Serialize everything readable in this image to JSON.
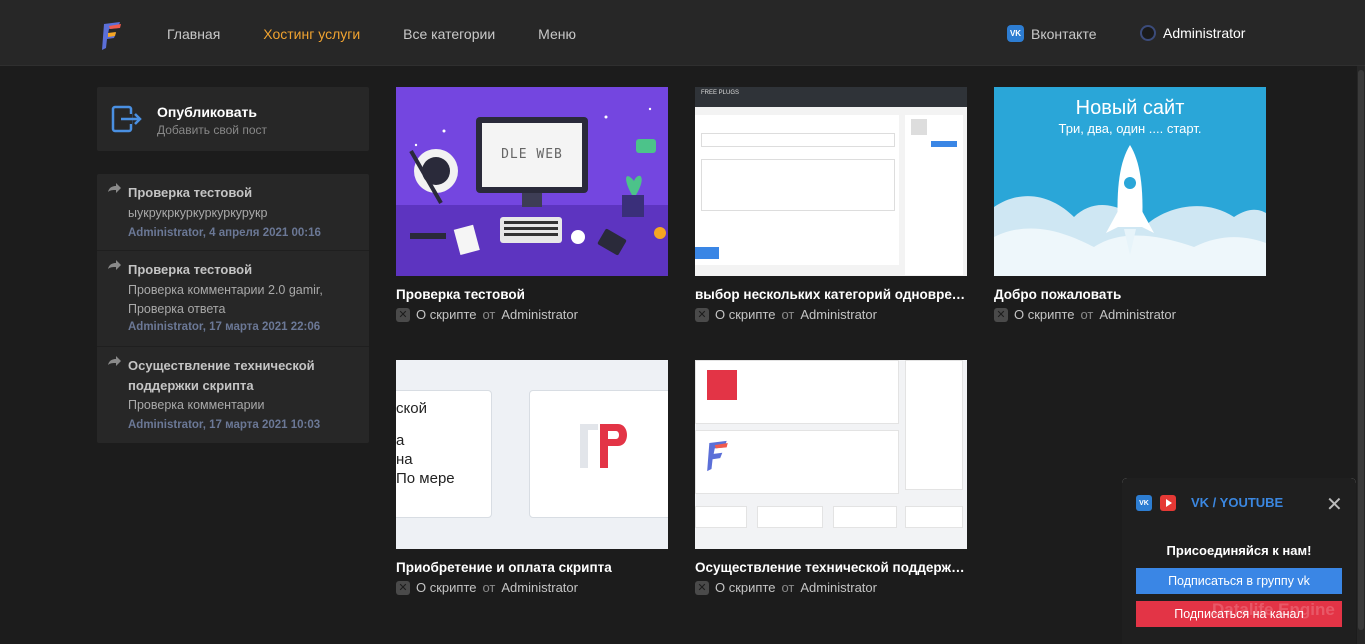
{
  "header": {
    "nav": [
      "Главная",
      "Хостинг услуги",
      "Все категории",
      "Меню"
    ],
    "active_index": 1,
    "vk_label": "Вконтакте",
    "vk_badge": "VK",
    "user_name": "Administrator"
  },
  "sidebar": {
    "publish_title": "Опубликовать",
    "publish_subtitle": "Добавить свой пост",
    "comments": [
      {
        "title": "Проверка тестовой",
        "text": "ыукрукркуркуркуркурукр",
        "meta": "Administrator, 4 апреля 2021 00:16"
      },
      {
        "title": "Проверка тестовой",
        "text": "Проверка комментарии 2.0   gamir, Проверка ответа",
        "meta": "Administrator, 17 марта 2021 22:06"
      },
      {
        "title": "Осуществление технической поддержки скрипта",
        "text": "Проверка комментарии",
        "meta": "Administrator, 17 марта 2021 10:03"
      }
    ]
  },
  "posts": [
    {
      "title": "Проверка тестовой",
      "category": "О скрипте",
      "by": "от",
      "author": "Administrator",
      "thumb_text": "DLE WEB"
    },
    {
      "title": "выбор нескольких категорий одновременно",
      "category": "О скрипте",
      "by": "от",
      "author": "Administrator",
      "thumb_text": "FREE PLUGS"
    },
    {
      "title": "Добро пожаловать",
      "category": "О скрипте",
      "by": "от",
      "author": "Administrator",
      "thumb_title": "Новый сайт",
      "thumb_sub": "Три, два, один .... старт."
    },
    {
      "title": "Приобретение и оплата скрипта",
      "category": "О скрипте",
      "by": "от",
      "author": "Administrator",
      "thumb_lines": [
        "ской",
        "а",
        "на",
        "По мере"
      ]
    },
    {
      "title": "Осуществление технической поддержки скрипта",
      "category": "О скрипте",
      "by": "от",
      "author": "Administrator"
    }
  ],
  "popup": {
    "title": "VK / YOUTUBE",
    "vk_badge": "VK",
    "close": "✕",
    "text": "Присоединяйся к нам!",
    "vk_button": "Подписаться в группу vk",
    "yt_button": "Подписаться на канал"
  },
  "watermark": "Datalife Engine",
  "colors": {
    "accent": "#f0a330",
    "vk": "#3a86e5",
    "youtube": "#e33446",
    "meta": "#6b7896"
  }
}
